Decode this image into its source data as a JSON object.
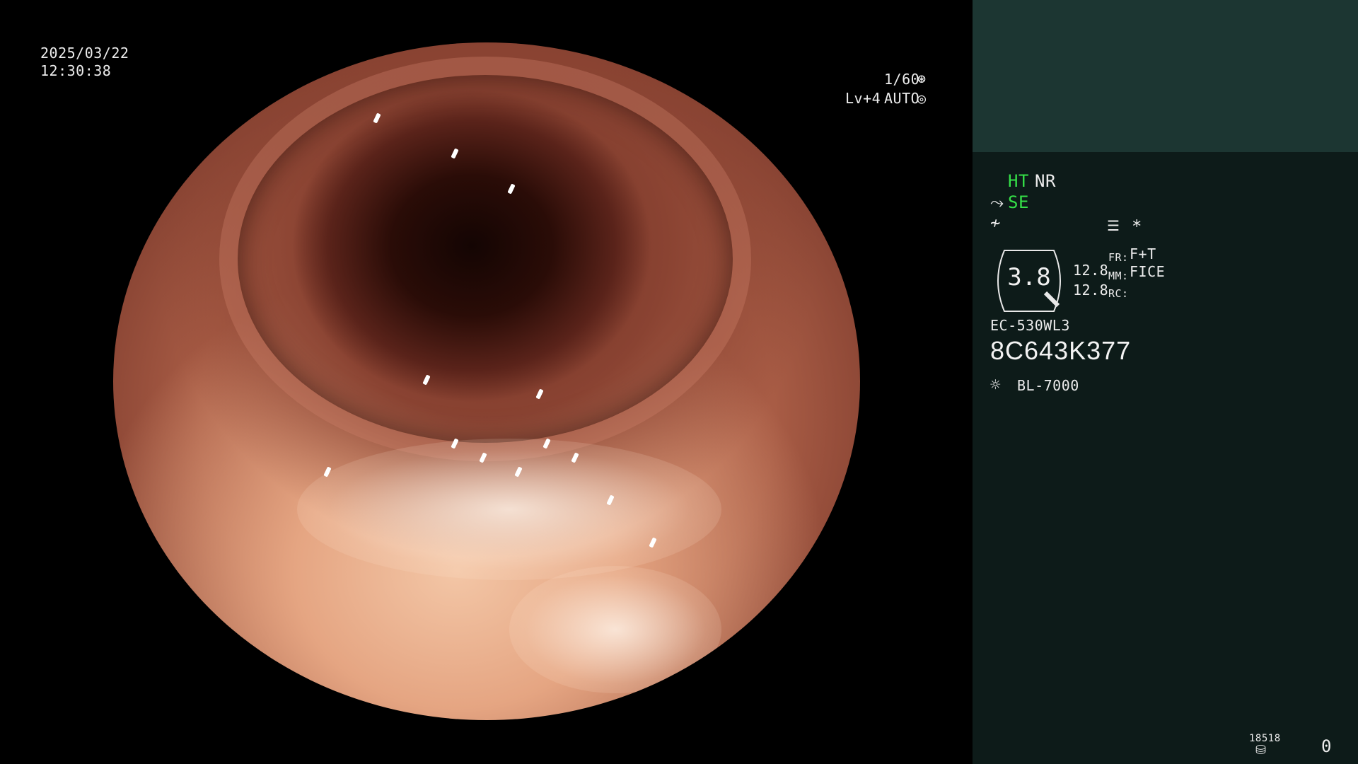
{
  "datetime": {
    "date": "2025/03/22",
    "time": "12:30:38"
  },
  "exposure": {
    "shutter": "1/60",
    "level": "Lv+4",
    "mode": "AUTO"
  },
  "panel": {
    "ht": "HT",
    "nr": "NR",
    "se": "SE",
    "gauge_value": "3.8",
    "val_upper": "12.8",
    "val_lower": "12.8",
    "fr_label": "FR:",
    "fr_value": "F+T",
    "mm_label": "MM:",
    "mm_value": "FICE",
    "rc_label": "RC:",
    "scope_model": "EC-530WL3",
    "scope_serial": "8C643K377",
    "light_source": "BL-7000",
    "storage_count": "18518",
    "counter": "0",
    "asterisk": "*"
  },
  "colors": {
    "accent_green": "#35e048",
    "panel_bg": "#0d1b19",
    "panel_top": "#1c3632"
  }
}
